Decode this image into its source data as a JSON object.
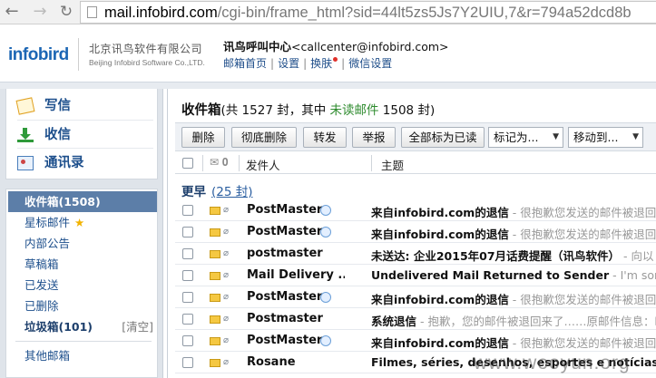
{
  "browser": {
    "url_host": "mail.infobird.com",
    "url_rest": "/cgi-bin/frame_html?sid=44lt5zs5Js7Y2UIU,7&r=794a52dcd8b",
    "icons": [
      "back-arrow-icon",
      "forward-arrow-icon",
      "reload-icon",
      "page-icon"
    ]
  },
  "header": {
    "logo": "infobird",
    "company_cn": "北京讯鸟软件有限公司",
    "company_en": "Beijing Infobird Software Co.,LTD.",
    "account_name": "讯鸟呼叫中心",
    "account_email": "<callcenter@infobird.com>",
    "links": [
      "邮箱首页",
      "设置",
      "换肤",
      "微信设置"
    ]
  },
  "sidebar": {
    "quick": [
      {
        "label": "写信",
        "icon": "compose-icon"
      },
      {
        "label": "收信",
        "icon": "receive-icon"
      },
      {
        "label": "通讯录",
        "icon": "contacts-icon"
      }
    ],
    "folders": [
      {
        "label": "收件箱(1508)"
      },
      {
        "label": "星标邮件",
        "icon": "star-icon"
      },
      {
        "label": "内部公告"
      },
      {
        "label": "草稿箱"
      },
      {
        "label": "已发送"
      },
      {
        "label": "已删除"
      },
      {
        "label": "垃圾箱(101)",
        "action": "[清空]"
      },
      {
        "label": "其他邮箱"
      }
    ]
  },
  "main": {
    "title": "收件箱",
    "summary_pre": "(共 1527 封，其中 ",
    "summary_unread": "未读邮件",
    "summary_post": " 1508 封)",
    "toolbar": {
      "delete": "删除",
      "delete_perm": "彻底删除",
      "forward": "转发",
      "report": "举报",
      "mark_all_read": "全部标为已读",
      "mark_as": "标记为...",
      "move_to": "移动到..."
    },
    "columns": {
      "sender": "发件人",
      "subject": "主题"
    },
    "group": {
      "label": "更早",
      "count": "(25 封)"
    },
    "emails": [
      {
        "sender": "PostMaster",
        "subject": "来自infobird.com的退信",
        "preview": " - 很抱歉您发送的邮件被退回，",
        "badge": true
      },
      {
        "sender": "PostMaster",
        "subject": "来自infobird.com的退信",
        "preview": " - 很抱歉您发送的邮件被退回，",
        "badge": true
      },
      {
        "sender": "postmaster",
        "subject": "未送达: 企业2015年07月话费提醒（讯鸟软件）",
        "preview": " - 向以",
        "badge": false
      },
      {
        "sender": "Mail Delivery ...",
        "subject": "Undelivered Mail Returned to Sender",
        "preview": " - I'm sorry",
        "badge": false
      },
      {
        "sender": "PostMaster",
        "subject": "来自infobird.com的退信",
        "preview": " - 很抱歉您发送的邮件被退回，",
        "badge": true
      },
      {
        "sender": "Postmaster",
        "subject": "系统退信",
        "preview": " - 抱歉，您的邮件被退回来了……原邮件信息：时",
        "badge": false
      },
      {
        "sender": "PostMaster",
        "subject": "来自infobird.com的退信",
        "preview": " - 很抱歉您发送的邮件被退回，",
        "badge": true
      },
      {
        "sender": "Rosane",
        "subject": "Filmes, séries, desenhos, esportes e notícias. To",
        "preview": "",
        "badge": false
      }
    ]
  },
  "watermark": "www.wooyun.org",
  "colors": {
    "accent": "#5c7ea8",
    "link": "#1d4f8c",
    "unread": "#2e8b2e",
    "sidebar_bg": "#dfe4ea"
  }
}
